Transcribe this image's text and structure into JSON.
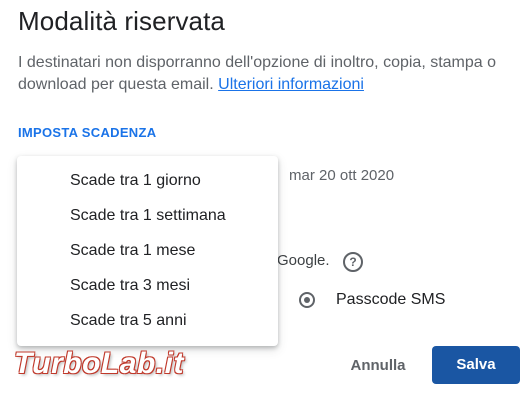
{
  "dialog": {
    "title": "Modalità riservata",
    "description": "I destinatari non disporranno dell'opzione di inoltro, copia, stampa o download per questa email.",
    "learn_more": "Ulteriori informazioni",
    "section_label": "IMPOSTA SCADENZA",
    "expiry_date": "mar 20 ott 2020",
    "partial_text": "Google.",
    "help_icon": "help-circle-icon",
    "radio_label": "Passcode SMS",
    "cancel_label": "Annulla",
    "save_label": "Salva"
  },
  "dropdown": {
    "items": [
      {
        "label": "Scade tra 1 giorno"
      },
      {
        "label": "Scade tra 1 settimana"
      },
      {
        "label": "Scade tra 1 mese"
      },
      {
        "label": "Scade tra 3 mesi"
      },
      {
        "label": "Scade tra 5 anni"
      }
    ]
  },
  "watermark": {
    "text": "TurboLab.it"
  },
  "colors": {
    "accent": "#1a73e8",
    "save_button": "#1a56a3",
    "watermark_outline": "#c0392b"
  }
}
